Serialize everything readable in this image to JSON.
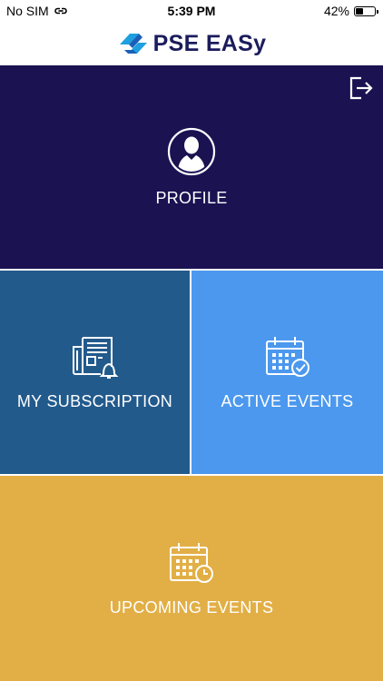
{
  "status_bar": {
    "carrier": "No SIM",
    "time": "5:39 PM",
    "battery": "42%",
    "battery_level": 0.42
  },
  "header": {
    "logo_text": "PSE EASy"
  },
  "colors": {
    "profile_bg": "#1b1252",
    "subscription_bg": "#225a8c",
    "active_bg": "#4b98ee",
    "upcoming_bg": "#e2af46"
  },
  "tiles": {
    "profile": {
      "label": "PROFILE",
      "icon": "user-avatar-icon"
    },
    "subscription": {
      "label": "MY SUBSCRIPTION",
      "icon": "newspaper-bell-icon"
    },
    "active": {
      "label": "ACTIVE EVENTS",
      "icon": "calendar-check-icon"
    },
    "upcoming": {
      "label": "UPCOMING EVENTS",
      "icon": "calendar-clock-icon"
    }
  },
  "logout": {
    "icon": "logout-icon"
  }
}
